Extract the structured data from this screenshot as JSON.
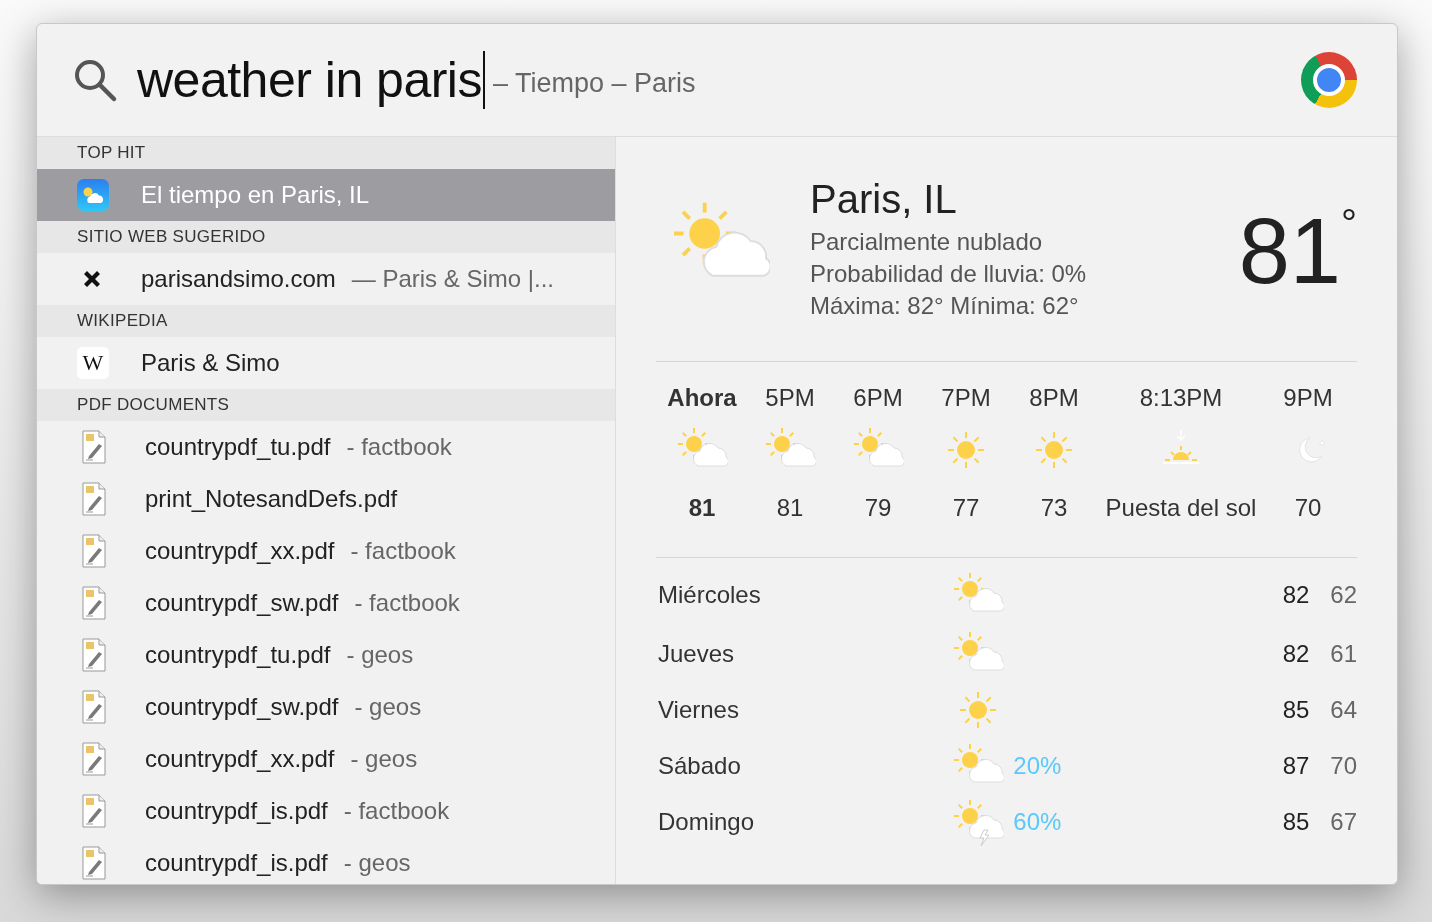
{
  "search": {
    "query": "weather in paris",
    "suggestion": "– Tiempo – Paris"
  },
  "sections": [
    {
      "title": "TOP HIT",
      "items": [
        {
          "kind": "weather",
          "title": "El tiempo en Paris, IL",
          "selected": true
        }
      ]
    },
    {
      "title": "SITIO WEB SUGERIDO",
      "items": [
        {
          "kind": "website",
          "title": "parisandsimo.com",
          "subtitle": "— Paris & Simo |...",
          "selected": false
        }
      ]
    },
    {
      "title": "WIKIPEDIA",
      "items": [
        {
          "kind": "wikipedia",
          "icon_letter": "W",
          "title": "Paris & Simo",
          "selected": false
        }
      ]
    },
    {
      "title": "PDF DOCUMENTS",
      "items": [
        {
          "kind": "pdf",
          "title": "countrypdf_tu.pdf",
          "subtitle": "- factbook",
          "selected": false
        },
        {
          "kind": "pdf",
          "title": "print_NotesandDefs.pdf",
          "selected": false
        },
        {
          "kind": "pdf",
          "title": "countrypdf_xx.pdf",
          "subtitle": "- factbook",
          "selected": false
        },
        {
          "kind": "pdf",
          "title": "countrypdf_sw.pdf",
          "subtitle": "- factbook",
          "selected": false
        },
        {
          "kind": "pdf",
          "title": "countrypdf_tu.pdf",
          "subtitle": "- geos",
          "selected": false
        },
        {
          "kind": "pdf",
          "title": "countrypdf_sw.pdf",
          "subtitle": "- geos",
          "selected": false
        },
        {
          "kind": "pdf",
          "title": "countrypdf_xx.pdf",
          "subtitle": "- geos",
          "selected": false
        },
        {
          "kind": "pdf",
          "title": "countrypdf_is.pdf",
          "subtitle": "- factbook",
          "selected": false
        },
        {
          "kind": "pdf",
          "title": "countrypdf_is.pdf",
          "subtitle": "- geos",
          "selected": false
        }
      ]
    }
  ],
  "weather": {
    "city": "Paris, IL",
    "kind": "partly_cloudy",
    "details": [
      "Parcialmente nublado",
      "Probabilidad de lluvia: 0%",
      "Máxima: 82°  Mínima: 62°"
    ],
    "temp": "81",
    "unit": "°",
    "hourly": [
      {
        "time": "Ahora",
        "kind": "partly_cloudy",
        "value": "81",
        "current": true
      },
      {
        "time": "5PM",
        "kind": "partly_cloudy",
        "value": "81",
        "current": false
      },
      {
        "time": "6PM",
        "kind": "partly_cloudy",
        "value": "79",
        "current": false
      },
      {
        "time": "7PM",
        "kind": "sunny",
        "value": "77",
        "current": false
      },
      {
        "time": "8PM",
        "kind": "sunny",
        "value": "73",
        "current": false
      },
      {
        "time": "8:13PM",
        "kind": "sunset",
        "value": "Puesta del sol",
        "current": false
      },
      {
        "time": "9PM",
        "kind": "moon",
        "value": "70",
        "current": false
      }
    ],
    "daily": [
      {
        "day": "Miércoles",
        "kind": "partly_cloudy",
        "high": "82",
        "low": "62"
      },
      {
        "day": "Jueves",
        "kind": "partly_cloudy",
        "high": "82",
        "low": "61"
      },
      {
        "day": "Viernes",
        "kind": "sunny",
        "high": "85",
        "low": "64"
      },
      {
        "day": "Sábado",
        "kind": "partly_cloudy",
        "precip": "20%",
        "high": "87",
        "low": "70"
      },
      {
        "day": "Domingo",
        "kind": "storm",
        "precip": "60%",
        "high": "85",
        "low": "67"
      }
    ]
  }
}
